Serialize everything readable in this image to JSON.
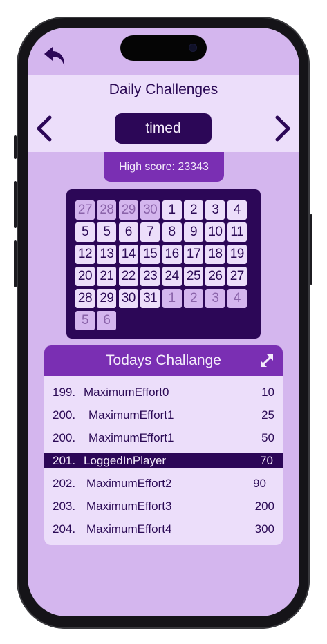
{
  "header": {
    "title": "Daily Challenges",
    "mode": "timed"
  },
  "high_score": "High score: 23343",
  "calendar": {
    "weeks": [
      [
        {
          "d": "27",
          "o": true
        },
        {
          "d": "28",
          "o": true
        },
        {
          "d": "29",
          "o": true
        },
        {
          "d": "30",
          "o": true
        },
        {
          "d": "1",
          "o": false
        },
        {
          "d": "2",
          "o": false
        },
        {
          "d": "3",
          "o": false
        },
        {
          "d": "4",
          "o": false
        }
      ],
      [
        {
          "d": "5",
          "o": false
        },
        {
          "d": "5",
          "o": false
        },
        {
          "d": "6",
          "o": false
        },
        {
          "d": "7",
          "o": false
        },
        {
          "d": "8",
          "o": false
        },
        {
          "d": "9",
          "o": false
        },
        {
          "d": "10",
          "o": false
        },
        {
          "d": "11",
          "o": false
        }
      ],
      [
        {
          "d": "12",
          "o": false
        },
        {
          "d": "13",
          "o": false
        },
        {
          "d": "14",
          "o": false
        },
        {
          "d": "15",
          "o": false
        },
        {
          "d": "16",
          "o": false
        },
        {
          "d": "17",
          "o": false
        },
        {
          "d": "18",
          "o": false
        },
        {
          "d": "19",
          "o": false
        }
      ],
      [
        {
          "d": "20",
          "o": false
        },
        {
          "d": "21",
          "o": false
        },
        {
          "d": "22",
          "o": false
        },
        {
          "d": "23",
          "o": false
        },
        {
          "d": "24",
          "o": false
        },
        {
          "d": "25",
          "o": false
        },
        {
          "d": "26",
          "o": false
        },
        {
          "d": "27",
          "o": false
        }
      ],
      [
        {
          "d": "28",
          "o": false
        },
        {
          "d": "29",
          "o": false
        },
        {
          "d": "30",
          "o": false
        },
        {
          "d": "31",
          "o": false
        },
        {
          "d": "1",
          "o": true
        },
        {
          "d": "2",
          "o": true
        },
        {
          "d": "3",
          "o": true
        },
        {
          "d": "4",
          "o": true
        }
      ],
      [
        {
          "d": "5",
          "o": true
        },
        {
          "d": "6",
          "o": true
        }
      ]
    ]
  },
  "leaderboard": {
    "title": "Todays Challange",
    "rows": [
      {
        "rank": "199.",
        "name": "MaximumEffort0",
        "score": "10",
        "highlight": false
      },
      {
        "rank": "200.",
        "name": "MaximumEffort1",
        "score": "25",
        "highlight": false
      },
      {
        "rank": "200.",
        "name": "MaximumEffort1",
        "score": "50",
        "highlight": false
      },
      {
        "rank": "201.",
        "name": "LoggedInPlayer",
        "score": "70",
        "highlight": true
      },
      {
        "rank": "202.",
        "name": "MaximumEffort2",
        "score": "90",
        "highlight": false
      },
      {
        "rank": "203.",
        "name": "MaximumEffort3",
        "score": "200",
        "highlight": false
      },
      {
        "rank": "204.",
        "name": "MaximumEffort4",
        "score": "300",
        "highlight": false
      }
    ]
  },
  "icons": {
    "back": "undo-arrow-icon",
    "prev": "chevron-left-icon",
    "next": "chevron-right-icon",
    "expand": "expand-arrows-icon"
  },
  "colors": {
    "background": "#d4b6ee",
    "panel_light": "#ecdefa",
    "dark_purple": "#2c0757",
    "accent_purple": "#7a2fb3"
  }
}
